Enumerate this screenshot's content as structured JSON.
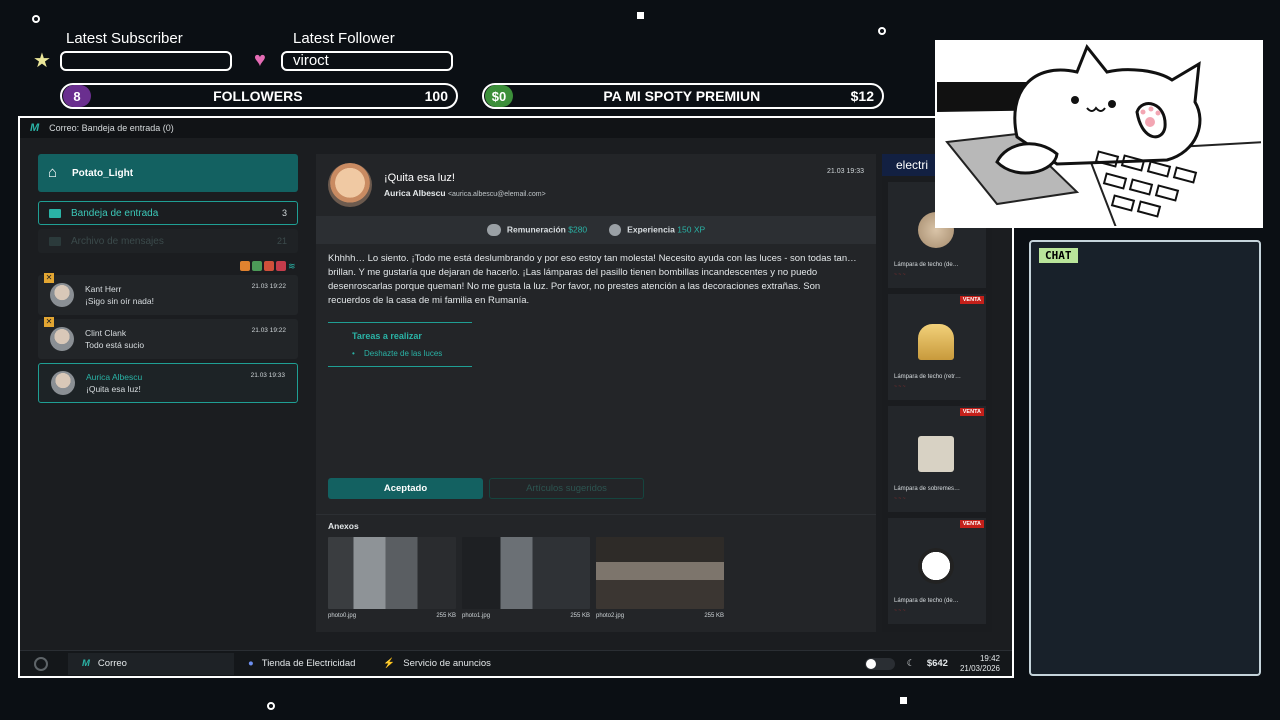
{
  "overlay": {
    "latest_subscriber_label": "Latest Subscriber",
    "latest_subscriber_value": "",
    "latest_follower_label": "Latest Follower",
    "latest_follower_value": "viroct",
    "followers_goal": {
      "current": "8",
      "title": "FOLLOWERS",
      "target": "100",
      "progress": 0.08
    },
    "money_goal": {
      "current": "$0",
      "title": "PA MI SPOTY PREMIUN",
      "target": "$12",
      "progress": 0.0
    },
    "chat_label": "CHAT"
  },
  "app": {
    "window_title": "Correo: Bandeja de entrada (0)",
    "logo": "M",
    "username": "Potato_Light",
    "nav": [
      {
        "label": "Bandeja de entrada",
        "count": "3"
      },
      {
        "label": "Archivo de mensajes",
        "count": "21"
      }
    ],
    "messages": [
      {
        "sender": "Kant Herr",
        "preview": "¡Sigo sin oír nada!",
        "date": "21.03 19:22"
      },
      {
        "sender": "Clint Clank",
        "preview": "Todo está sucio",
        "date": "21.03 19:22"
      },
      {
        "sender": "Aurica Albescu",
        "preview": "¡Quita esa luz!",
        "date": "21.03 19:33"
      }
    ],
    "email": {
      "subject": "¡Quita esa luz!",
      "sender": "Aurica Albescu",
      "address": "<aurica.albescu@elemail.com>",
      "date": "21.03 19:33",
      "reward_label": "Remuneración",
      "reward_value": "$280",
      "xp_label": "Experiencia",
      "xp_value": "150 XP",
      "body": "Khhhh… Lo siento. ¡Todo me está deslumbrando y por eso estoy tan molesta! Necesito ayuda con las luces - son todas tan… brillan. Y me gustaría que dejaran de hacerlo. ¡Las lámparas del pasillo tienen bombillas incandescentes y no puedo desenroscarlas porque queman! No me gusta la luz. Por favor, no prestes atención a las decoraciones extrañas. Son recuerdos de la casa de mi familia en Rumanía.",
      "tasks_title": "Tareas a realizar",
      "tasks": [
        "Deshazte de las luces"
      ],
      "accept_label": "Aceptado",
      "suggested_label": "Artículos sugeridos",
      "attachments_title": "Anexos",
      "attachments": [
        {
          "name": "photo0.jpg",
          "size": "255 KB"
        },
        {
          "name": "photo1.jpg",
          "size": "255 KB"
        },
        {
          "name": "photo2.jpg",
          "size": "255 KB"
        }
      ]
    },
    "shop": {
      "title": "electri",
      "sale_label": "VENTA",
      "items": [
        {
          "name": "Lámpara de techo (de…",
          "sale": false
        },
        {
          "name": "Lámpara de techo (retr…",
          "sale": true
        },
        {
          "name": "Lámpara de sobremes…",
          "sale": true
        },
        {
          "name": "Lámpara de techo (de…",
          "sale": true
        }
      ]
    },
    "taskbar": {
      "items": [
        "Correo",
        "Tienda de Electricidad",
        "Servicio de anuncios"
      ],
      "money": "$642",
      "time": "19:42",
      "date": "21/03/2026"
    }
  }
}
